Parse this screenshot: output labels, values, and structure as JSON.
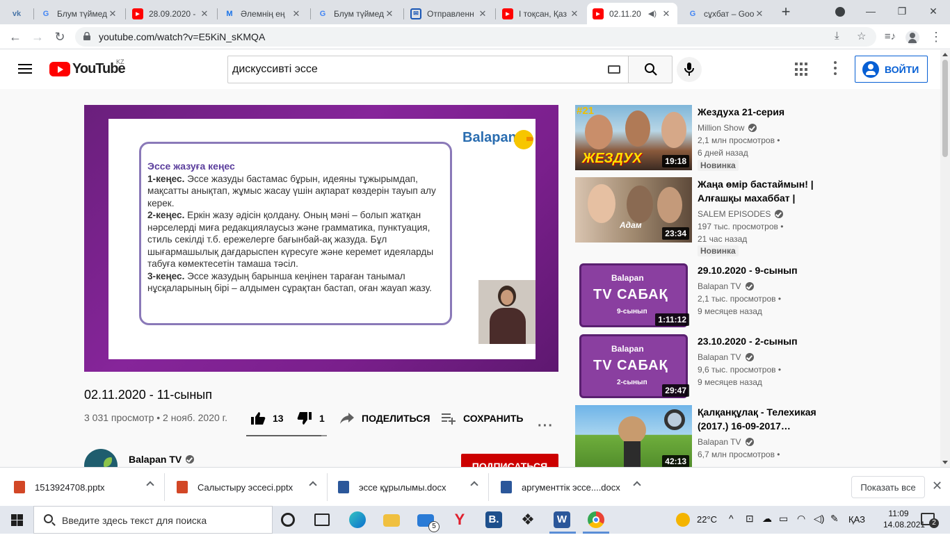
{
  "browser": {
    "tabs": [
      {
        "title": "",
        "icon": "vk-icon"
      },
      {
        "title": "Блум түймед",
        "icon": "google-icon"
      },
      {
        "title": "28.09.2020 -",
        "icon": "youtube-icon"
      },
      {
        "title": "Әлемнің ең",
        "icon": "m-icon"
      },
      {
        "title": "Блум түймед",
        "icon": "google-icon"
      },
      {
        "title": "Отправленн",
        "icon": "mail-icon"
      },
      {
        "title": "І тоқсан, Қаз",
        "icon": "youtube-icon"
      },
      {
        "title": "02.11.20",
        "icon": "youtube-icon",
        "active": true
      },
      {
        "title": "сұхбат – Goo",
        "icon": "google-icon"
      }
    ],
    "url": "youtube.com/watch?v=E5KiN_sKMQA"
  },
  "youtube": {
    "logo_text": "YouTube",
    "country": "KZ",
    "search_value": "дискуссивті эссе",
    "signin_label": "ВОЙТИ"
  },
  "video": {
    "slide": {
      "brand": "Balapan",
      "title": "Эссе жазуға кеңес",
      "tip1_label": "1-кеңес.",
      "tip1_text": " Эссе жазуды бастамас бұрын, идеяны тұжырымдап, мақсатты анықтап, жұмыс жасау үшін ақпарат көздерін тауып алу керек.",
      "tip2_label": "2-кеңес.",
      "tip2_text": " Еркін жазу әдісін қолдану. Оның мәні – болып жатқан нәрселерді миға редакциялаусыз және грамматика, пунктуация, стиль секілді т.б. ережелерге бағынбай-ақ жазуда. Бұл шығармашылық дағдарыспен күресуге және керемет идеяларды табуға көмектесетін тамаша тәсіл.",
      "tip3_label": "3-кеңес.",
      "tip3_text": " Эссе жазудың барынша кеңінен тараған танымал нұсқаларының бірі – алдымен сұрақтан бастап, оған жауап жазу."
    },
    "title": "02.11.2020 - 11-сынып",
    "meta": "3 031 просмотр • 2 нояб. 2020 г.",
    "likes": "13",
    "likes_ratio": 0.93,
    "dislikes": "1",
    "share_label": "ПОДЕЛИТЬСЯ",
    "save_label": "СОХРАНИТЬ",
    "channel": "Balapan TV",
    "subscribe_label": "ПОДПИСАТЬСЯ"
  },
  "recommendations": [
    {
      "title": "Жездуха 21-серия",
      "channel": "Million Show",
      "views": "2,1 млн просмотров •",
      "age": "6 дней назад",
      "badge": "Новинка",
      "duration": "19:18"
    },
    {
      "title": "Жаңа өмір бастаймын! | Алғашқы махаббат | Соңғы…",
      "channel": "SALEM EPISODES",
      "views": "197 тыс. просмотров •",
      "age": "21 час назад",
      "badge": "Новинка",
      "duration": "23:34"
    },
    {
      "title": "29.10.2020 - 9-сынып",
      "channel": "Balapan TV",
      "views": "2,1 тыс. просмотров •",
      "age": "9 месяцев назад",
      "duration": "1:11:12"
    },
    {
      "title": "23.10.2020 - 2-сынып",
      "channel": "Balapan TV",
      "views": "9,6 тыс. просмотров •",
      "age": "9 месяцев назад",
      "duration": "29:47"
    },
    {
      "title": "Қалқанқұлақ - Телехикая (2017.) 16-09-2017…",
      "channel": "Balapan TV",
      "views": "6,7 млн просмотров •",
      "age": "",
      "duration": "42:13"
    }
  ],
  "thumb_text": {
    "rec1_tag": "#21",
    "rec1_word": "ЖЕЗДУХ",
    "rec2_word": "Адам",
    "tv_brand": "Balapan",
    "tv_word": "TV САБАҚ",
    "rec3_grade": "9-сынып",
    "rec4_grade": "2-сынып"
  },
  "downloads": [
    {
      "name": "1513924708.pptx",
      "type": "pptx"
    },
    {
      "name": "Салыстыру эссесі.pptx",
      "type": "pptx"
    },
    {
      "name": "эссе құрылымы.docx",
      "type": "docx"
    },
    {
      "name": "аргументтік эссе....docx",
      "type": "docx"
    }
  ],
  "show_all_label": "Показать все",
  "taskbar": {
    "search_placeholder": "Введите здесь текст для поиска",
    "weather": "22°C",
    "language": "ҚАЗ",
    "time": "11:09",
    "date": "14.08.2021",
    "notifications": "2",
    "mail_badge": "5"
  },
  "colors": {
    "youtube_red": "#ff0000",
    "player_purple": "#7a1f8c",
    "link_blue": "#065fd4",
    "subscribe_red": "#cc0000"
  }
}
